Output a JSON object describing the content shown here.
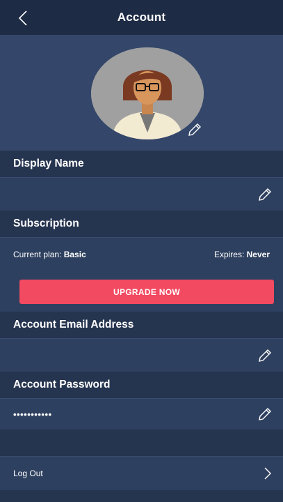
{
  "header": {
    "title": "Account",
    "back_icon": "chevron-left-icon"
  },
  "profile": {
    "avatar_icon": "avatar-woman-illustration",
    "edit_icon": "pencil-icon"
  },
  "display_name": {
    "section_label": "Display Name",
    "value": "",
    "edit_icon": "pencil-icon"
  },
  "subscription": {
    "section_label": "Subscription",
    "plan_label": "Current plan:",
    "plan_value": "Basic",
    "expires_label": "Expires:",
    "expires_value": "Never",
    "upgrade_label": "UPGRADE NOW"
  },
  "email": {
    "section_label": "Account Email Address",
    "value": "",
    "edit_icon": "pencil-icon"
  },
  "password": {
    "section_label": "Account Password",
    "value": "•••••••••••",
    "edit_icon": "pencil-icon"
  },
  "logout": {
    "label": "Log Out",
    "icon": "chevron-right-icon"
  },
  "colors": {
    "navbar": "#1e2b44",
    "background": "#2e405f",
    "section_header": "#25344f",
    "accent_button": "#f24a61"
  }
}
